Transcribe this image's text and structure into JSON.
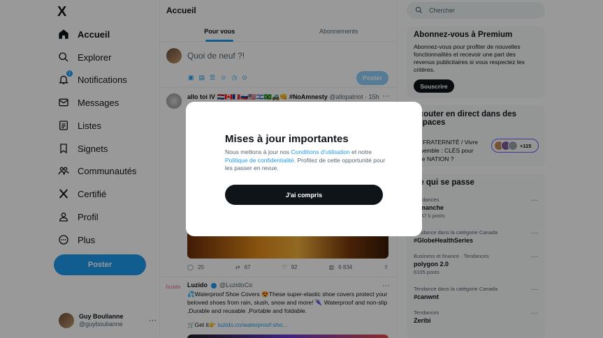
{
  "sidebar": {
    "logo": "X",
    "items": [
      {
        "label": "Accueil",
        "icon": "home-icon",
        "active": true
      },
      {
        "label": "Explorer",
        "icon": "search-icon"
      },
      {
        "label": "Notifications",
        "icon": "bell-icon",
        "badge": "1"
      },
      {
        "label": "Messages",
        "icon": "mail-icon"
      },
      {
        "label": "Listes",
        "icon": "list-icon"
      },
      {
        "label": "Signets",
        "icon": "bookmark-icon"
      },
      {
        "label": "Communautés",
        "icon": "communities-icon"
      },
      {
        "label": "Certifié",
        "icon": "x-logo-icon"
      },
      {
        "label": "Profil",
        "icon": "user-icon"
      },
      {
        "label": "Plus",
        "icon": "more-circle-icon"
      }
    ],
    "post_button": "Poster",
    "profile": {
      "name": "Guy Boulianne",
      "handle": "@guyboulianne",
      "more": "···"
    }
  },
  "main": {
    "title": "Accueil",
    "tabs": [
      {
        "label": "Pour vous",
        "active": true
      },
      {
        "label": "Abonnements"
      }
    ],
    "compose": {
      "placeholder": "Quoi de neuf ?!",
      "post_button": "Poster"
    },
    "tweet1": {
      "name": "allo toi IV 🇳🇱🇨🇦🇫🇷🇷🇺🇺🇸🇮🇱🇧🇷🚜👊 #NoAmnesty",
      "handle": "@allopatriot",
      "time": "· 15h",
      "actions": {
        "replies": "20",
        "retweets": "67",
        "likes": "92",
        "views": "6 834"
      }
    },
    "tweet2": {
      "logo_text": "luzido",
      "name": "Luzido",
      "handle": "@LuzidoCo",
      "body": "💦Waterproof Shoe Covers 😍These super-elastic shoe covers protect your beloved shoes from rain, slush, snow and more! 🌂 Waterproof and non-slip ,Durable and reusable ,Portable and foldable.",
      "link_prefix": "🛒Get it👉",
      "link": "luzido.co/waterproof-sho..."
    }
  },
  "right": {
    "search_placeholder": "Chercher",
    "premium": {
      "title": "Abonnez-vous à Premium",
      "text": "Abonnez-vous pour profiter de nouvelles fonctionnalités et recevoir une part des revenus publicitaires si vous respectez les critères.",
      "button": "Souscrire"
    },
    "spaces": {
      "title": "Écouter en direct dans des espaces",
      "space_title": "🎤 FRATERNITÉ / Vivre ensemble : CLÉS pour faire NATION ?",
      "count": "+115"
    },
    "trends": {
      "title": "Ce qui se passe",
      "items": [
        {
          "category": "Tendances",
          "name": "Dimanche",
          "count": "2 947 k posts"
        },
        {
          "category": "Tendance dans la catégorie Canada",
          "name": "#GlobeHealthSeries",
          "count": ""
        },
        {
          "category": "Business et finance · Tendances",
          "name": "polygon 2.0",
          "count": "6105 posts"
        },
        {
          "category": "Tendance dans la catégorie Canada",
          "name": "#canwnt",
          "count": ""
        },
        {
          "category": "Tendances",
          "name": "Zeribi",
          "count": ""
        }
      ]
    }
  },
  "modal": {
    "title": "Mises à jour importantes",
    "text_1": "Nous mettons à jour nos ",
    "link_1": "Conditions d'utilisation",
    "text_2": " et notre ",
    "link_2": "Politique de confidentialité",
    "text_3": ". Profitez de cette opportunité pour les passer en revue.",
    "button": "J'ai compris"
  },
  "colors": {
    "accent": "#1d9bf0",
    "text": "#0f1419",
    "muted": "#536471",
    "overlay": "rgba(0,0,0,0.40)"
  }
}
